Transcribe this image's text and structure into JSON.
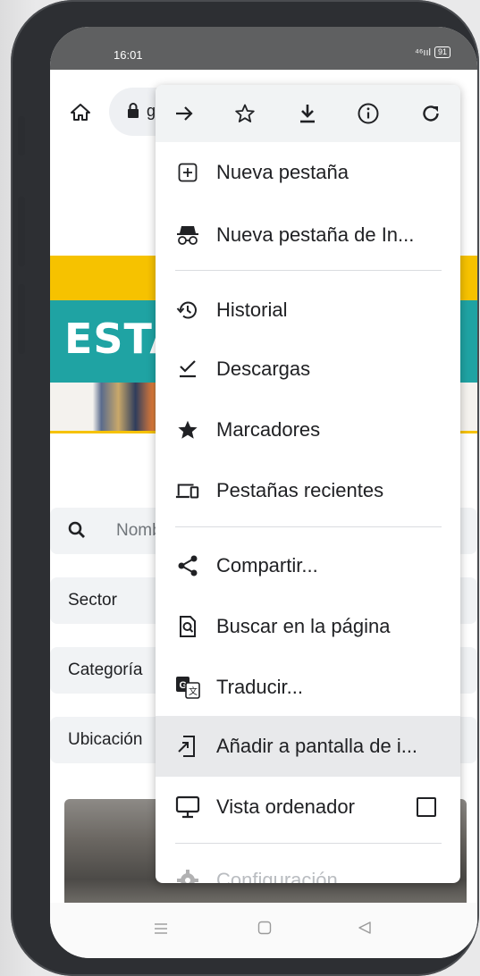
{
  "status_bar": {
    "time": "16:01",
    "signal": "⁴⁶ııl",
    "battery": "91"
  },
  "url_bar": {
    "text": "gé"
  },
  "toolbar_actions": [
    "forward-icon",
    "star-icon",
    "download-icon",
    "info-icon",
    "reload-icon"
  ],
  "banner": {
    "title": "ESTA"
  },
  "filters": {
    "search_placeholder": "Nomb",
    "sector": "Sector",
    "categoria": "Categoría",
    "ubicacion": "Ubicación"
  },
  "menu": {
    "items": [
      {
        "label": "Nueva pestaña",
        "icon": "plus-box-icon"
      },
      {
        "label": "Nueva pestaña de In...",
        "icon": "incognito-icon"
      },
      {
        "label": "Historial",
        "icon": "history-icon"
      },
      {
        "label": "Descargas",
        "icon": "download-done-icon"
      },
      {
        "label": "Marcadores",
        "icon": "star-filled-icon"
      },
      {
        "label": "Pestañas recientes",
        "icon": "devices-icon"
      },
      {
        "label": "Compartir...",
        "icon": "share-icon"
      },
      {
        "label": "Buscar en la página",
        "icon": "find-in-page-icon"
      },
      {
        "label": "Traducir...",
        "icon": "translate-icon"
      },
      {
        "label": "Añadir a pantalla de i...",
        "icon": "add-to-home-icon"
      },
      {
        "label": "Vista ordenador",
        "icon": "desktop-icon"
      },
      {
        "label": "Configuración",
        "icon": "settings-icon"
      }
    ],
    "highlighted_index": 9,
    "desktop_checked": false
  },
  "nav": [
    "menu-icon",
    "home-square-icon",
    "back-triangle-icon"
  ]
}
